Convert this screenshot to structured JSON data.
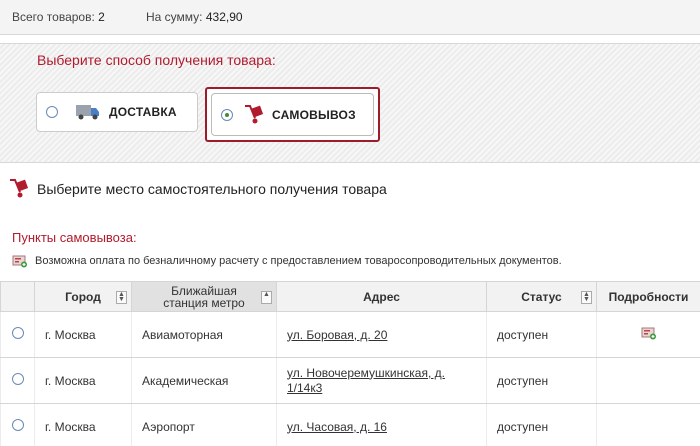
{
  "summary": {
    "items_label": "Всего товаров:",
    "items_count": "2",
    "sum_label": "На сумму:",
    "sum_value": "432,90"
  },
  "delivery_method": {
    "title": "Выберите способ получения товара:",
    "options": [
      {
        "label": "ДОСТАВКА",
        "selected": false,
        "icon": "truck-icon"
      },
      {
        "label": "САМОВЫВОЗ",
        "selected": true,
        "icon": "hand-truck-icon"
      }
    ]
  },
  "pickup": {
    "heading": "Выберите место самостоятельного получения товара",
    "points_title": "Пункты самовывоза:",
    "cashless_note": "Возможна оплата по безналичному расчету с предоставлением товаросопроводительных документов."
  },
  "table": {
    "columns": [
      "Город",
      "Ближайшая станция метро",
      "Адрес",
      "Статус",
      "Подробности"
    ],
    "rows": [
      {
        "city": "г. Москва",
        "metro": "Авиамоторная",
        "address": "ул. Боровая, д. 20",
        "status": "доступен",
        "has_details": true
      },
      {
        "city": "г. Москва",
        "metro": "Академическая",
        "address": "ул. Новочеремушкинская, д. 1/14к3",
        "status": "доступен",
        "has_details": false
      },
      {
        "city": "г. Москва",
        "metro": "Аэропорт",
        "address": "ул. Часовая, д. 16",
        "status": "доступен",
        "has_details": false
      }
    ]
  },
  "colors": {
    "accent_red": "#b11b2e",
    "status_green": "#2f8f1f"
  }
}
